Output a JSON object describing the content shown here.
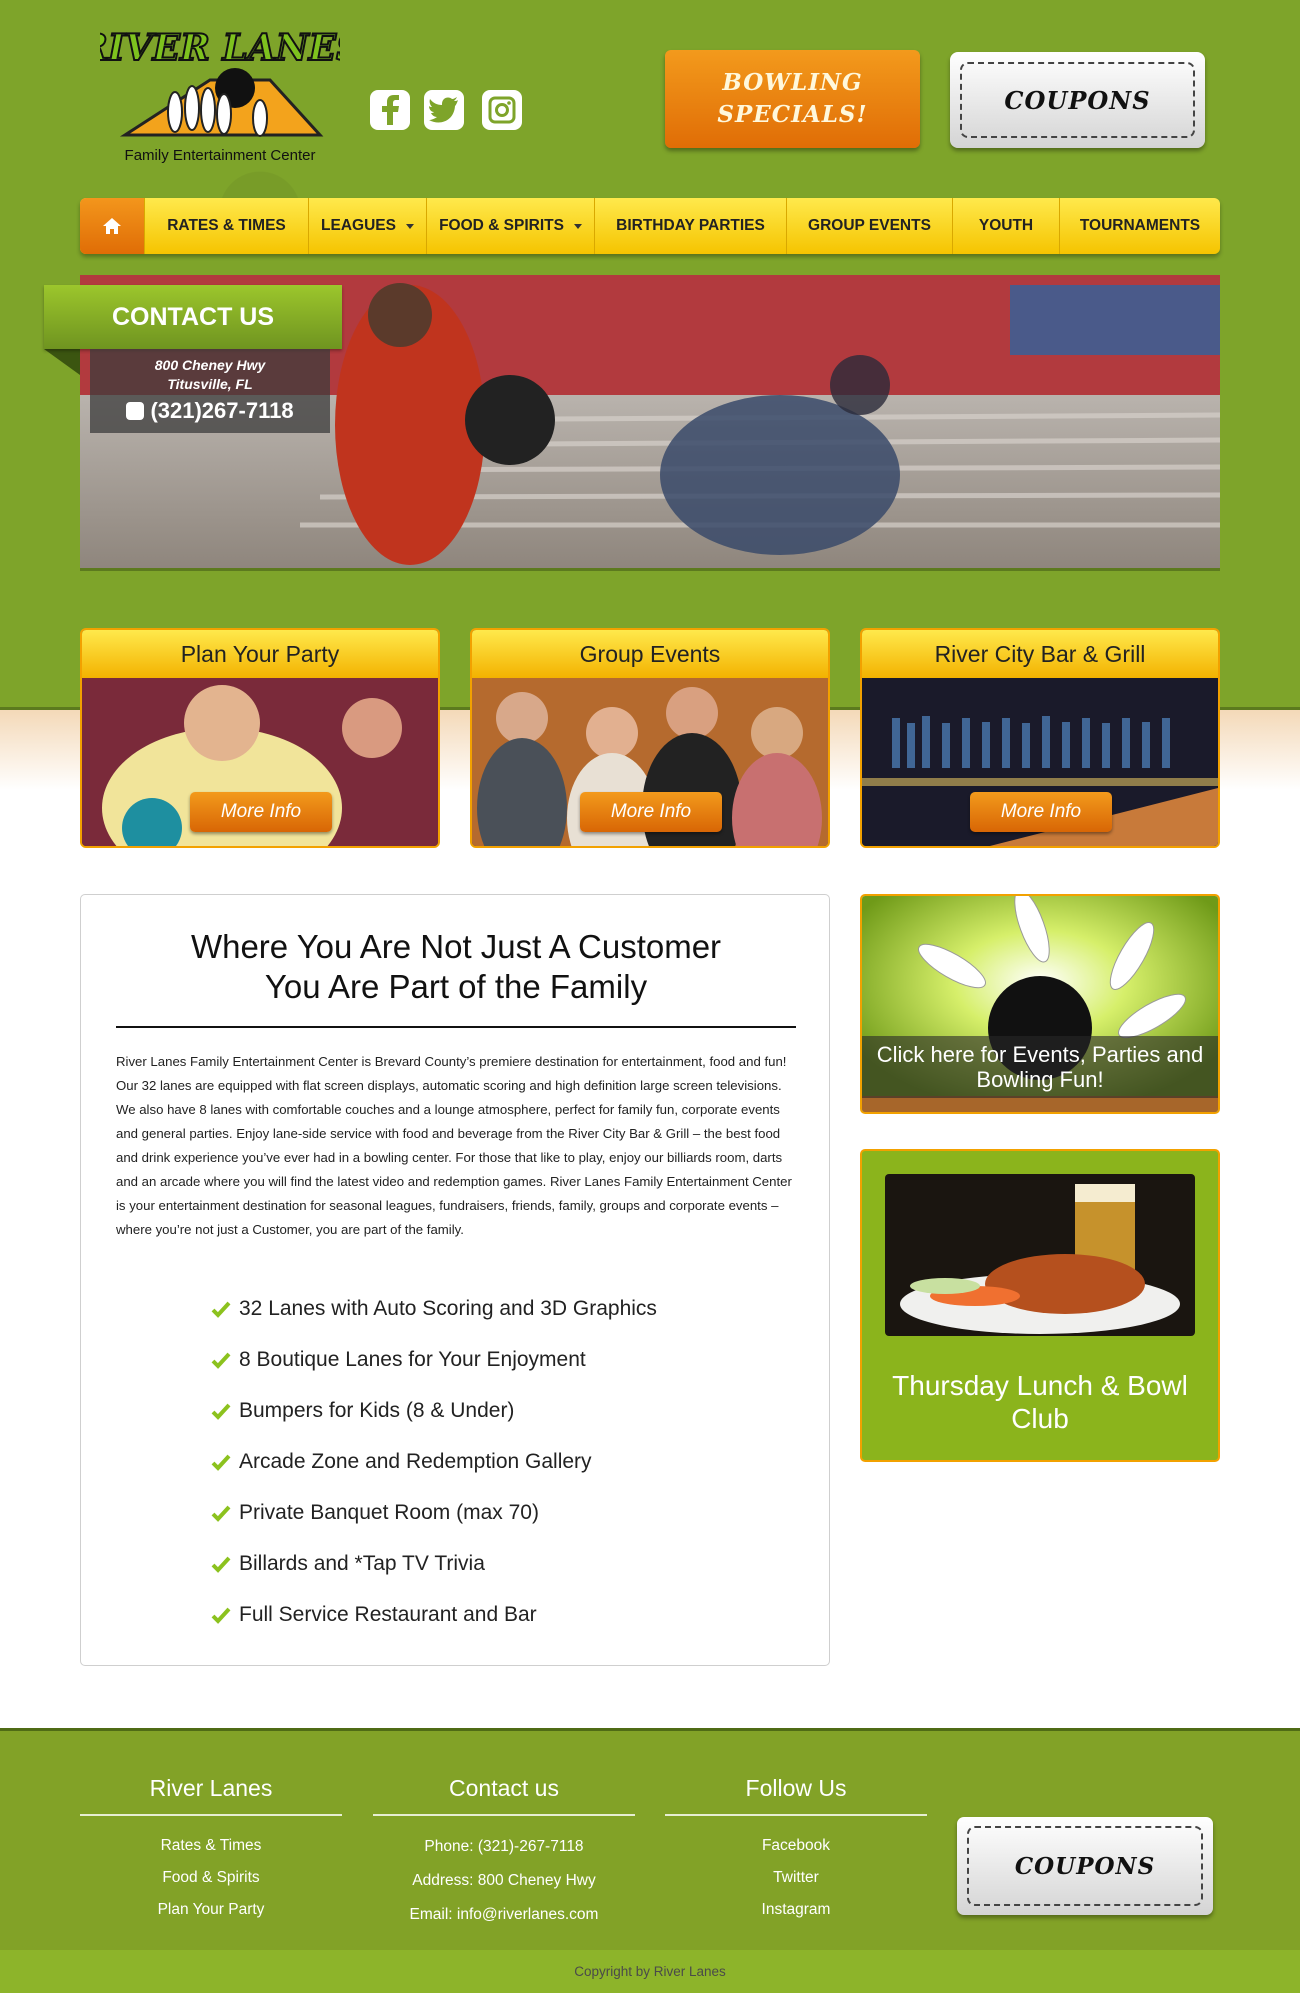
{
  "header": {
    "logo_title": "RIVER LANES",
    "logo_subtitle": "Family Entertainment Center",
    "specials_label": "Bowling Specials!",
    "coupons_label": "Coupons"
  },
  "social": [
    {
      "name": "facebook-icon"
    },
    {
      "name": "twitter-icon"
    },
    {
      "name": "instagram-icon"
    }
  ],
  "nav": {
    "home_icon": "home-icon",
    "items": [
      {
        "label": "Rates & Times",
        "dropdown": false
      },
      {
        "label": "Leagues",
        "dropdown": true
      },
      {
        "label": "Food & Spirits",
        "dropdown": true
      },
      {
        "label": "Birthday Parties",
        "dropdown": false
      },
      {
        "label": "Group Events",
        "dropdown": false
      },
      {
        "label": "Youth",
        "dropdown": false
      },
      {
        "label": "Tournaments",
        "dropdown": false
      }
    ]
  },
  "contact": {
    "tab_label": "CONTACT US",
    "address_line1": "800 Cheney Hwy",
    "address_line2": "Titusville, FL",
    "phone": "(321)267-7118"
  },
  "cards": [
    {
      "title": "Plan Your Party",
      "button": "More Info"
    },
    {
      "title": "Group Events",
      "button": "More Info"
    },
    {
      "title": "River City Bar & Grill",
      "button": "More Info"
    }
  ],
  "main": {
    "title_line1": "Where You Are Not Just A Customer",
    "title_line2": "You Are Part of the Family",
    "body": "River Lanes Family Entertainment Center is Brevard County’s premiere destination for entertainment, food and fun! Our 32 lanes are equipped with flat screen displays, automatic scoring and high definition large screen televisions. We also have 8 lanes with comfortable couches and a lounge atmosphere, perfect for family fun, corporate events and general parties. Enjoy lane-side service with food and beverage from the River City Bar & Grill – the best food and drink experience you’ve ever had in a bowling center. For those that like to play, enjoy our billiards room, darts and an arcade where you will find the latest video and redemption games. River Lanes Family Entertainment Center is your entertainment destination for seasonal leagues, fundraisers, friends, family, groups and corporate events – where you’re not just a Customer, you are part of the family.",
    "features": [
      "32 Lanes with Auto Scoring and 3D Graphics",
      "8 Boutique Lanes for Your Enjoyment",
      "Bumpers for Kids (8 & Under)",
      "Arcade Zone and Redemption Gallery",
      "Private Banquet Room (max 70)",
      "Billards and *Tap TV Trivia",
      "Full Service Restaurant and Bar"
    ]
  },
  "sidebar": {
    "events_ad": "Click here for Events, Parties and Bowling Fun!",
    "lunch_club": "Thursday Lunch & Bowl Club"
  },
  "footer": {
    "col1_title": "River Lanes",
    "col1_links": [
      "Rates & Times",
      "Food & Spirits",
      "Plan Your Party"
    ],
    "col2_title": "Contact us",
    "col2_lines": [
      "Phone: (321)-267-7118",
      "Address: 800 Cheney Hwy",
      "Email: info@riverlanes.com"
    ],
    "col3_title": "Follow Us",
    "col3_links": [
      "Facebook",
      "Twitter",
      "Instagram"
    ],
    "coupons_label": "Coupons",
    "copyright": "Copyright by River Lanes"
  },
  "colors": {
    "brand_green": "#7ea42a",
    "accent_orange": "#e06d06",
    "nav_yellow": "#f5c400"
  }
}
